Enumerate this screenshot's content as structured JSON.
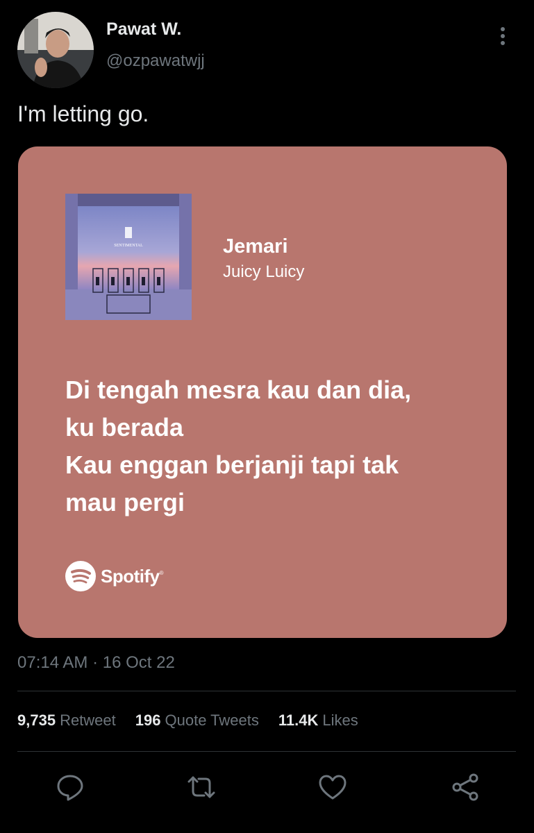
{
  "author": {
    "display_name": "Pawat W.",
    "handle": "@ozpawatwjj"
  },
  "tweet": {
    "text": "I'm letting go.",
    "timestamp": "07:14 AM · 16 Oct 22"
  },
  "card": {
    "background_color": "#b8766e",
    "song_title": "Jemari",
    "artist": "Juicy Luicy",
    "album_text": "SENTIMENTAL",
    "lyrics": [
      "Di tengah mesra kau dan dia,",
      "ku berada",
      "Kau enggan berjanji tapi tak",
      "mau pergi"
    ],
    "brand": "Spotify",
    "brand_mark": "®"
  },
  "stats": {
    "retweets": {
      "count": "9,735",
      "label": "Retweet"
    },
    "quotes": {
      "count": "196",
      "label": "Quote Tweets"
    },
    "likes": {
      "count": "11.4K",
      "label": "Likes"
    }
  },
  "actions": {
    "icons": [
      "reply-icon",
      "retweet-icon",
      "like-icon",
      "share-icon"
    ],
    "color": "#6e767d"
  }
}
